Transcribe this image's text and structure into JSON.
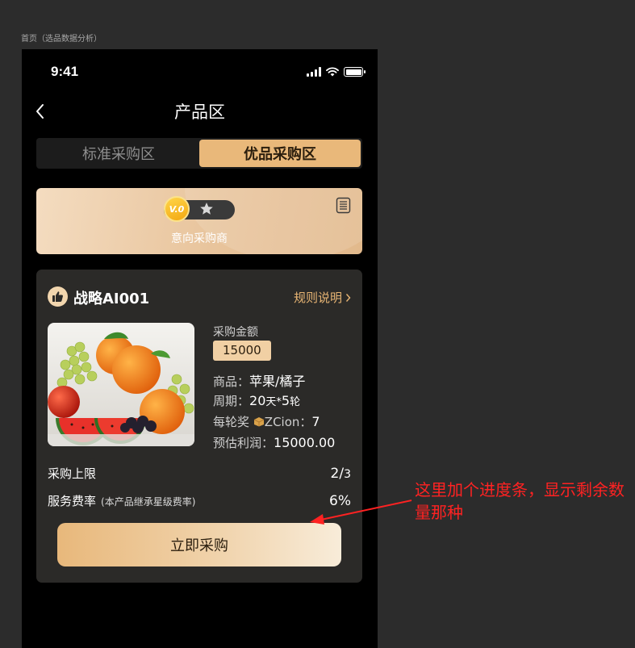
{
  "frame_label": "首页（选品数据分析）",
  "status_bar": {
    "time": "9:41"
  },
  "nav": {
    "title": "产品区"
  },
  "tabs": [
    {
      "label": "标准采购区",
      "active": false
    },
    {
      "label": "优品采购区",
      "active": true
    }
  ],
  "level": {
    "badge": "V.0",
    "name": "意向采购商"
  },
  "product": {
    "name": "战略AI001",
    "rules_link": "规则说明",
    "amount_label": "采购金额",
    "amount": "15000",
    "goods_label": "商品：",
    "goods": "苹果/橘子",
    "period_label": "周期：",
    "period_days": "20",
    "period_days_unit": "天",
    "period_sep": "*",
    "period_rounds": "5",
    "period_rounds_unit": "轮",
    "reward_label": "每轮奖",
    "reward_currency": "ZCion",
    "reward_sep": "：",
    "reward_value": "7",
    "profit_label": "预估利润：",
    "profit": "15000.00",
    "limit_label": "采购上限",
    "limit_used": "2/",
    "limit_total": "3",
    "limit_progress": 0.667,
    "fee_label": "服务费率",
    "fee_note": "(本产品继承星级费率)",
    "fee_value": "6%",
    "buy_button": "立即采购"
  },
  "annotation": "这里加个进度条，显示剩余数量那种",
  "colors": {
    "accent": "#e9b87a",
    "card_bg": "#2b2a28",
    "annotation": "#ff2222"
  }
}
